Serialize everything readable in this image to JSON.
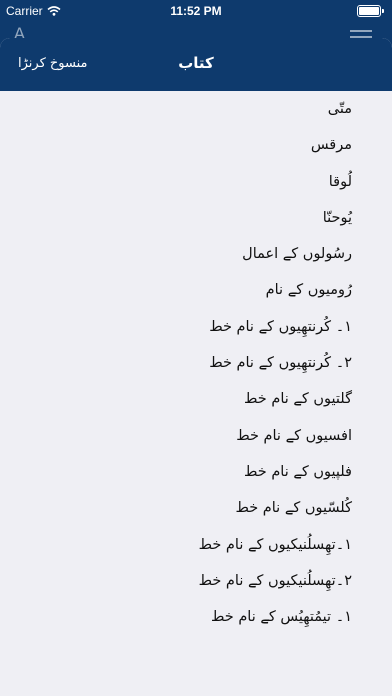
{
  "status_bar": {
    "carrier": "Carrier",
    "time": "11:52 PM",
    "battery_level": 1.0
  },
  "sheet": {
    "title": "کتاب",
    "cancel_label": "منسوخ کرنڑا"
  },
  "books": [
    {
      "label": "متّی"
    },
    {
      "label": "مرقس"
    },
    {
      "label": "لُوقا"
    },
    {
      "label": "یُوحنّا"
    },
    {
      "label": "رسُولوں کے اعمال"
    },
    {
      "label": "رُومیوں کے نام"
    },
    {
      "label": "۱۔ کُرنتھِیوں کے نام خط"
    },
    {
      "label": "۲۔ کُرنتھِیوں کے نام خط"
    },
    {
      "label": "گلتیوں کے نام خط"
    },
    {
      "label": "افسیوں کے نام خط"
    },
    {
      "label": "فلپیوں کے نام خط"
    },
    {
      "label": "کُلسّیوں کے نام خط"
    },
    {
      "label": "۱۔تھِسلُنیکیوں کے نام خط"
    },
    {
      "label": "۲۔تھِسلُنیکیوں کے نام خط"
    },
    {
      "label": "۱۔ تیمُتھِیُس کے نام خط"
    }
  ]
}
